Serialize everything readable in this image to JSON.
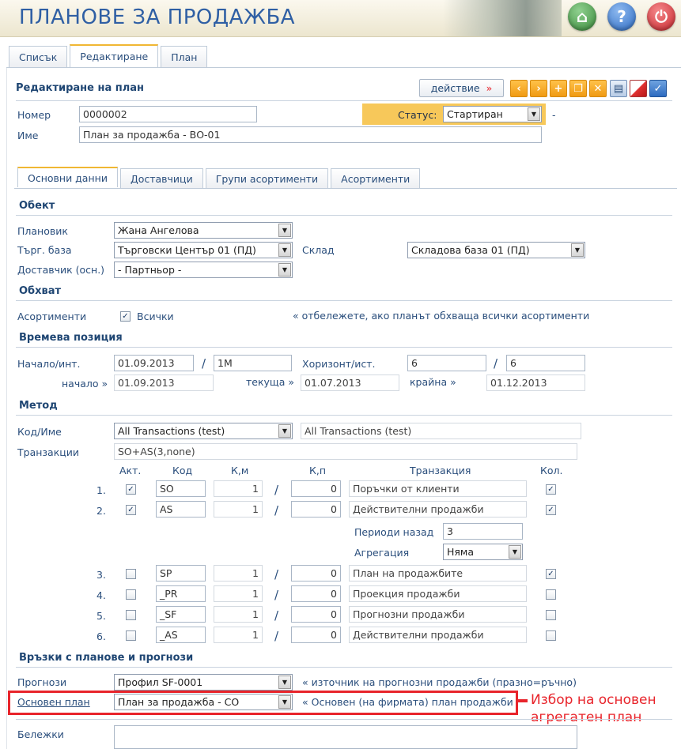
{
  "header": {
    "title": "ПЛАНОВЕ ЗА ПРОДАЖБА"
  },
  "tabs": [
    "Списък",
    "Редактиране",
    "План"
  ],
  "panel": {
    "title": "Редактиране на план",
    "action_label": "действие",
    "action_arrow": "»"
  },
  "toolbar_icons": [
    "prev-icon",
    "next-icon",
    "add-icon",
    "copy-icon",
    "delete-icon",
    "print-icon",
    "cancel-icon",
    "confirm-icon"
  ],
  "form": {
    "number_label": "Номер",
    "number_value": "0000002",
    "status_label": "Статус:",
    "status_value": "Стартиран",
    "status_dash": "-",
    "name_label": "Име",
    "name_value": "План за продажба - ВО-01"
  },
  "subtabs": [
    "Основни данни",
    "Доставчици",
    "Групи асортименти",
    "Асортименти"
  ],
  "object": {
    "title": "Обект",
    "planner_label": "Плановик",
    "planner_value": "Жана Ангелова",
    "base_label": "Търг. база",
    "base_value": "Търговски Център 01 (ПД)",
    "warehouse_label": "Склад",
    "warehouse_value": "Складова база 01 (ПД)",
    "supplier_label": "Доставчик (осн.)",
    "supplier_value": "- Партньор -"
  },
  "scope": {
    "title": "Обхват",
    "assort_label": "Асортименти",
    "all_label": "Всички",
    "hint": "« отбележете, ако планът обхваща всички асортименти"
  },
  "time": {
    "title": "Времева позиция",
    "start_label": "Начало/инт.",
    "start_value": "01.09.2013",
    "slash": "/",
    "interval_value": "1M",
    "horizon_label": "Хоризонт/ист.",
    "horizon_value": "6",
    "hist_value": "6",
    "begin_label": "начало »",
    "begin_value": "01.09.2013",
    "current_label": "текуща »",
    "current_value": "01.07.2013",
    "end_label": "крайна »",
    "end_value": "01.12.2013"
  },
  "method": {
    "title": "Метод",
    "code_label": "Код/Име",
    "code_value": "All Transactions (test)",
    "name_value": "All Transactions (test)",
    "trans_label": "Транзакции",
    "trans_value": "SO+AS(3,none)",
    "cols": {
      "act": "Акт.",
      "code": "Код",
      "km": "К,м",
      "kp": "К,п",
      "trans": "Транзакция",
      "qty": "Кол."
    },
    "rows": [
      {
        "n": "1.",
        "act": "✓",
        "code": "SO",
        "km": "1",
        "kp": "0",
        "trans": "Поръчки от клиенти",
        "qty": "✓"
      },
      {
        "n": "2.",
        "act": "✓",
        "code": "AS",
        "km": "1",
        "kp": "0",
        "trans": "Действителни продажби",
        "qty": "✓"
      },
      {
        "n": "3.",
        "act": "",
        "code": "SP",
        "km": "1",
        "kp": "0",
        "trans": "План на продажбите",
        "qty": "✓"
      },
      {
        "n": "4.",
        "act": "",
        "code": "_PR",
        "km": "1",
        "kp": "0",
        "trans": "Проекция продажби",
        "qty": ""
      },
      {
        "n": "5.",
        "act": "",
        "code": "_SF",
        "km": "1",
        "kp": "0",
        "trans": "Прогнозни продажби",
        "qty": ""
      },
      {
        "n": "6.",
        "act": "",
        "code": "_AS",
        "km": "1",
        "kp": "0",
        "trans": "Действителни продажби",
        "qty": ""
      }
    ],
    "periods_label": "Периоди назад",
    "periods_value": "3",
    "agg_label": "Агрегация",
    "agg_value": "Няма"
  },
  "links": {
    "title": "Връзки с планове и прогнози",
    "forecast_label": "Прогнози",
    "forecast_value": "Профил SF-0001",
    "forecast_hint": "« източник на прогнозни продажби (празно=ръчно)",
    "base_plan_label": "Основен план",
    "base_plan_value": "План за продажба - СО",
    "base_plan_hint": "« Основен (на фирмата) план продажби",
    "notes_label": "Бележки"
  },
  "annotation": {
    "line1": "Избор на основен",
    "line2": "агрегатен план",
    "color": "#e8242b"
  }
}
